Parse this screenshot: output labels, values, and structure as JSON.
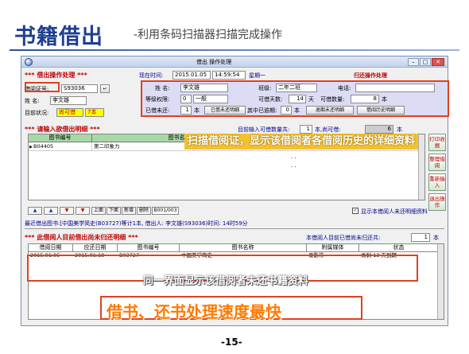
{
  "slide": {
    "title": "书籍借出",
    "subtitle": "-利用条码扫描器扫描完成操作",
    "page_number": "-15-"
  },
  "window": {
    "title": "借出 操作处理",
    "header_left": "*** 借出操作处理 ***",
    "now_label": "现在时间:",
    "now_date": "2015.01.05",
    "now_time": "14:59:54",
    "now_weekday": "星期一",
    "return_label": "归还操作处理"
  },
  "borrower": {
    "card_label": "借阅证号:",
    "card_value": "S93036",
    "name_label": "姓  名:",
    "name_value": "李文雄",
    "status_label": "目前状况:",
    "status_value": "尚可借",
    "status_count": "7本"
  },
  "info": {
    "name_label": "姓  名:",
    "name_value": "李文雄",
    "class_label": "班级:",
    "class_value": "二年二班",
    "phone_label": "电话:",
    "phone_value": "",
    "level_label": "等级权限:",
    "level_code": "0",
    "level_value": "一般",
    "days_label": "可借天数:",
    "days_value": "14",
    "days_unit": "天",
    "qty_label": "可借数量:",
    "qty_value": "8",
    "qty_unit": "本",
    "borrowed_label": "已借未还:",
    "borrowed_value": "1",
    "borrowed_unit": "本",
    "borrowed_btn": "已借未还明细",
    "overdue_label": "其中已逾期:",
    "overdue_value": "0",
    "overdue_unit": "本",
    "overdue_btn": "逾期未还明细",
    "history_btn": "借阅历史明细"
  },
  "input_section": {
    "heading": "*** 请输入欲借出明细 ***",
    "count_label": "目前输入可借数量共:",
    "count_value": "1",
    "count_unit": "本,尚可借:",
    "remain_value": "6",
    "remain_unit": "本",
    "columns": [
      "图书编号",
      "图书名称"
    ],
    "rows": [
      {
        "code": "B04405",
        "name": "第二印象力"
      }
    ],
    "dots_1": ". .",
    "dots_2": ". ."
  },
  "side_buttons": [
    "打印收据",
    "整理借阅",
    "重新输入",
    "退出操作"
  ],
  "nav": {
    "buttons": [
      "▲",
      "▲",
      "▼",
      "▼"
    ],
    "page_up": "上面",
    "page_down": "下面",
    "add": "新增",
    "delete": "删除",
    "record": "B001/003",
    "show_unreturned": "显示本借阅人未还明细资料"
  },
  "recent": {
    "text": "最近借出图书:[中国美学简史(B03727)等计1本, 借出人: 李文雄(S93036)时间: 14时59分"
  },
  "unreturned": {
    "heading": "*** 此借阅人目前借出尚未归还明细 ***",
    "count_label": "本借阅人目前已借尚未归还共:",
    "count_value": "1",
    "count_unit": "本",
    "columns": [
      "借阅日期",
      "应还日期",
      "图书编号",
      "图书名称",
      "附属媒体",
      "状态"
    ],
    "rows": [
      {
        "borrow_date": "2015.01.05",
        "due_date": "2015.01.18",
        "code": "B03727",
        "name": "中国美学简史",
        "media": "录影带",
        "status": "尚剩   13 天到期"
      }
    ]
  },
  "callouts": {
    "scan": "扫描借阅证，显示该借阅者各借阅历史的详细资料",
    "same_screen": "同一界面显示该借阅者未还书籍资料",
    "speed": "借书、还书处理速度最快"
  },
  "colors": {
    "accent_red": "#e04020",
    "title_blue": "#1f3f8f",
    "callout_yellow": "#f2c230",
    "speed_orange": "#ff7a00"
  }
}
